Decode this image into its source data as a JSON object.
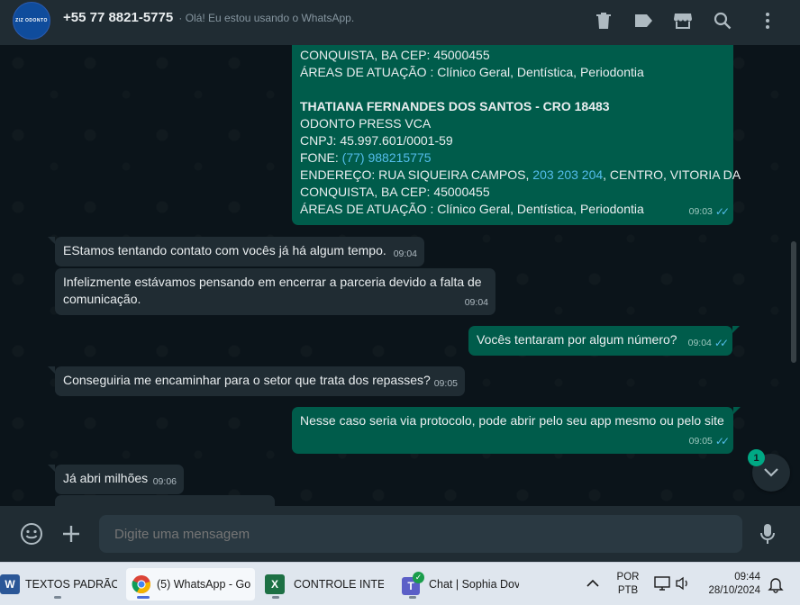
{
  "header": {
    "avatar_text": "ZIZ ODONTO",
    "contact_name": "+55 77 8821-5775",
    "contact_status": "· Olá! Eu estou usando o WhatsApp."
  },
  "messages": {
    "m0": {
      "l1": "CONQUISTA, BA CEP: 45000455",
      "l2": "ÁREAS DE ATUAÇÃO : Clínico Geral, Dentística, Periodontia",
      "l3": "THATIANA FERNANDES DOS SANTOS - CRO 18483",
      "l4": "ODONTO PRESS VCA",
      "l5": "CNPJ: 45.997.601/0001-59",
      "l6_prefix": "FONE: ",
      "l6_link": "(77) 988215775",
      "l7_prefix": "ENDEREÇO: RUA SIQUEIRA CAMPOS, ",
      "l7_link": "203 203 204",
      "l7_suffix": ", CENTRO, VITORIA DA",
      "l8": "CONQUISTA, BA CEP: 45000455",
      "l9": "ÁREAS DE ATUAÇÃO : Clínico Geral, Dentística, Periodontia",
      "time": "09:03"
    },
    "m1": {
      "text": "EStamos tentando contato com vocês já há algum tempo.",
      "time": "09:04"
    },
    "m2": {
      "l1": "Infelizmente estávamos pensando em encerrar a parceria devido a falta de",
      "l2": "comunicação.",
      "time": "09:04"
    },
    "m3": {
      "text": "Vocês tentaram por algum número?",
      "time": "09:04"
    },
    "m4": {
      "text": "Conseguiria me encaminhar para o setor que trata dos repasses?",
      "time": "09:05"
    },
    "m5": {
      "text": "Nesse caso seria via protocolo, pode abrir pelo seu app mesmo ou pelo site",
      "time": "09:05"
    },
    "m6": {
      "text": "Já abri milhões",
      "time": "09:06"
    }
  },
  "unread_count": "1",
  "composer": {
    "placeholder": "Digite uma mensagem"
  },
  "taskbar": {
    "task1": "TEXTOS PADRÃO T",
    "task2": "(5) WhatsApp - Go",
    "task3": "CONTROLE INTERN",
    "task4": "Chat | Sophia Dov",
    "lang1": "POR",
    "lang2": "PTB",
    "time": "09:44",
    "date": "28/10/2024"
  },
  "colors": {
    "accent": "#00a884",
    "outgoing_bubble": "#005c4b",
    "incoming_bubble": "#202c33",
    "read_ticks": "#53bdeb"
  },
  "icons": [
    "delete-icon",
    "label-icon",
    "store-icon",
    "search-icon",
    "menu-icon",
    "emoji-icon",
    "attach-plus-icon",
    "microphone-icon",
    "chevron-down-icon"
  ]
}
